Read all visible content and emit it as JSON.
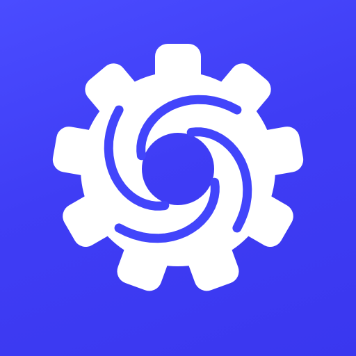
{
  "app_icon": {
    "name": "Gear logo",
    "background_color": "#4245fb",
    "foreground_color": "#ffffff",
    "icon": "gear-icon",
    "inner_mark": "swirl-aperture-icon"
  }
}
